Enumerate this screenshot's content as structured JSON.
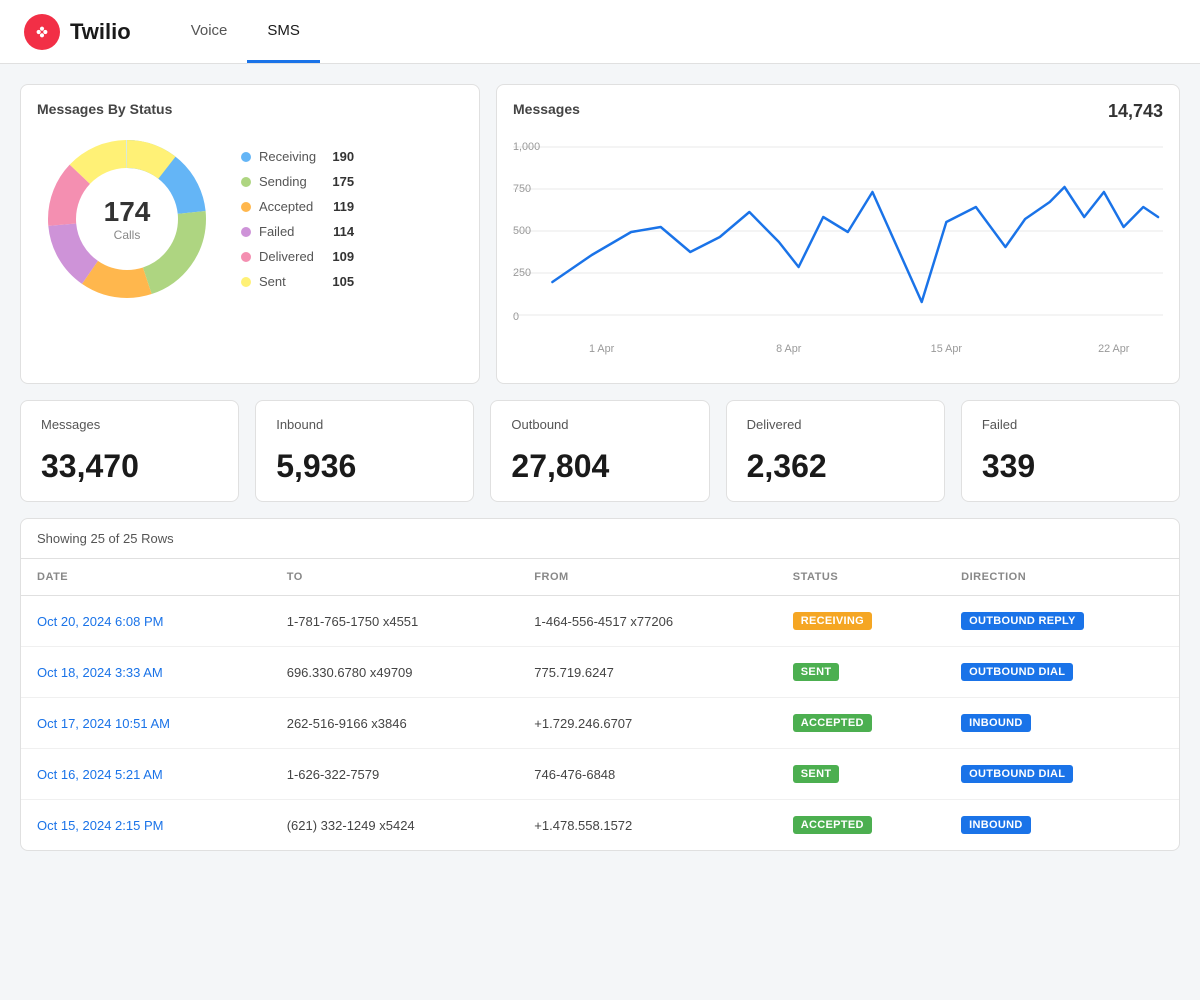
{
  "header": {
    "logo_text": "Twilio",
    "nav_items": [
      {
        "label": "Voice",
        "active": false
      },
      {
        "label": "SMS",
        "active": true
      }
    ]
  },
  "status_card": {
    "title": "Messages By Status",
    "donut_center_number": "174",
    "donut_center_label": "Calls",
    "legend": [
      {
        "label": "Receiving",
        "value": "190",
        "color": "#64b5f6"
      },
      {
        "label": "Sending",
        "value": "175",
        "color": "#aed581"
      },
      {
        "label": "Accepted",
        "value": "119",
        "color": "#ffb74d"
      },
      {
        "label": "Failed",
        "value": "114",
        "color": "#ce93d8"
      },
      {
        "label": "Delivered",
        "value": "109",
        "color": "#f48fb1"
      },
      {
        "label": "Sent",
        "value": "105",
        "color": "#fff176"
      }
    ],
    "donut_segments": [
      {
        "color": "#64b5f6",
        "pct": 0.272
      },
      {
        "color": "#aed581",
        "pct": 0.251
      },
      {
        "color": "#ffb74d",
        "pct": 0.171
      },
      {
        "color": "#ce93d8",
        "pct": 0.164
      },
      {
        "color": "#f48fb1",
        "pct": 0.157
      },
      {
        "color": "#fff176",
        "pct": 0.151
      }
    ]
  },
  "messages_chart": {
    "title": "Messages",
    "total": "14,743",
    "x_labels": [
      "1 Apr",
      "8 Apr",
      "15 Apr",
      "22 Apr"
    ],
    "y_labels": [
      "1,000",
      "750",
      "500",
      "250",
      "0"
    ],
    "line_color": "#1a73e8"
  },
  "stats": [
    {
      "label": "Messages",
      "value": "33,470"
    },
    {
      "label": "Inbound",
      "value": "5,936"
    },
    {
      "label": "Outbound",
      "value": "27,804"
    },
    {
      "label": "Delivered",
      "value": "2,362"
    },
    {
      "label": "Failed",
      "value": "339"
    }
  ],
  "table": {
    "showing_text": "Showing 25 of 25 Rows",
    "columns": [
      "DATE",
      "TO",
      "FROM",
      "STATUS",
      "DIRECTION"
    ],
    "rows": [
      {
        "date": "Oct 20, 2024 6:08 PM",
        "to": "1-781-765-1750 x4551",
        "from": "1-464-556-4517 x77206",
        "status": "RECEIVING",
        "status_class": "receiving",
        "direction": "OUTBOUND REPLY",
        "dir_class": "outbound-reply"
      },
      {
        "date": "Oct 18, 2024 3:33 AM",
        "to": "696.330.6780 x49709",
        "from": "775.719.6247",
        "status": "SENT",
        "status_class": "sent",
        "direction": "OUTBOUND DIAL",
        "dir_class": "outbound-dial"
      },
      {
        "date": "Oct 17, 2024 10:51 AM",
        "to": "262-516-9166 x3846",
        "from": "+1.729.246.6707",
        "status": "ACCEPTED",
        "status_class": "accepted",
        "direction": "INBOUND",
        "dir_class": "inbound"
      },
      {
        "date": "Oct 16, 2024 5:21 AM",
        "to": "1-626-322-7579",
        "from": "746-476-6848",
        "status": "SENT",
        "status_class": "sent",
        "direction": "OUTBOUND DIAL",
        "dir_class": "outbound-dial"
      },
      {
        "date": "Oct 15, 2024 2:15 PM",
        "to": "(621) 332-1249 x5424",
        "from": "+1.478.558.1572",
        "status": "ACCEPTED",
        "status_class": "accepted",
        "direction": "INBOUND",
        "dir_class": "inbound"
      }
    ]
  }
}
